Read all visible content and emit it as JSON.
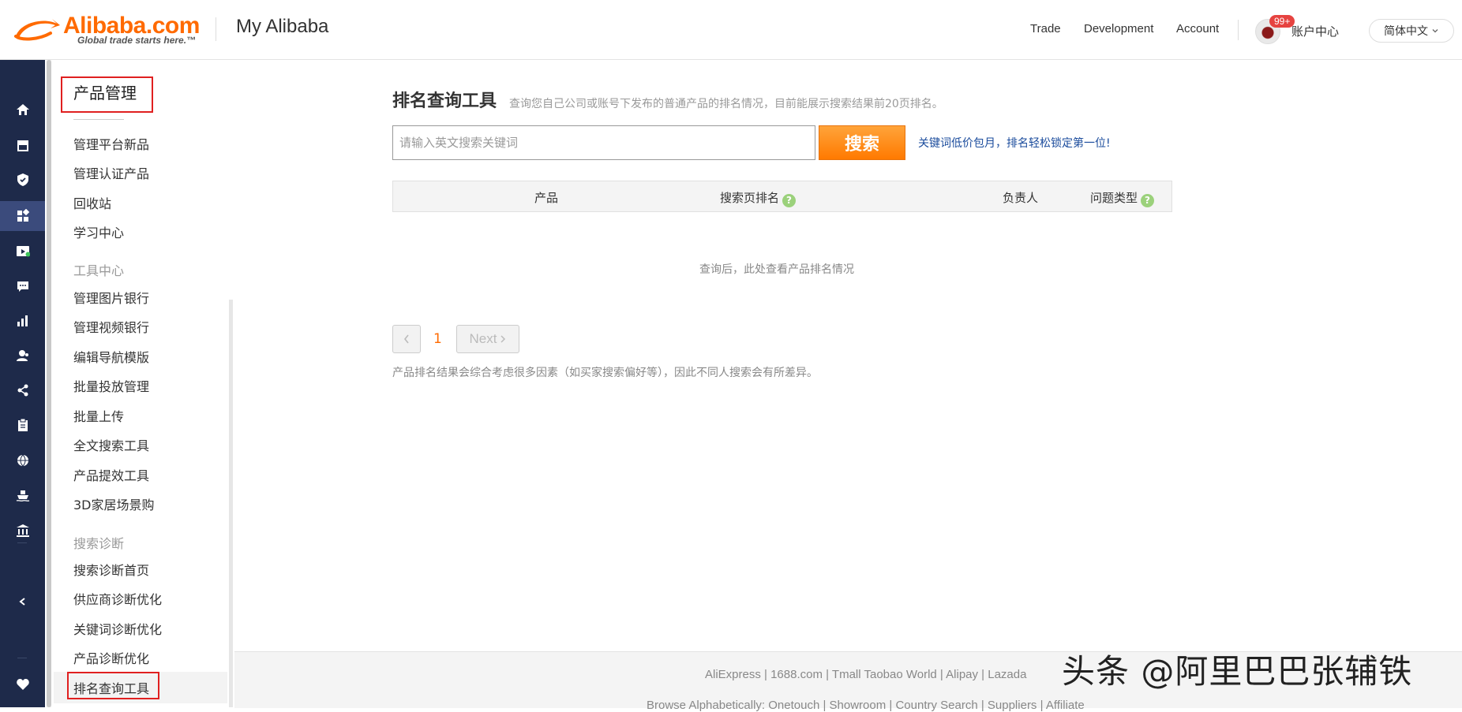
{
  "header": {
    "logo_word": "Alibaba.com",
    "logo_tagline": "Global trade starts here.™",
    "title": "My Alibaba",
    "nav": [
      "Trade",
      "Development",
      "Account"
    ],
    "badge": "99+",
    "account_center": "账户中心",
    "language": "简体中文"
  },
  "rail": {
    "icons": [
      "home-icon",
      "store-icon",
      "shield-icon",
      "apps-icon",
      "video-icon",
      "message-icon",
      "chart-icon",
      "users-icon",
      "network-icon",
      "clipboard-icon",
      "globe-icon",
      "ship-icon",
      "bank-icon",
      "collapse-icon",
      "heart-icon"
    ],
    "active": "apps-icon"
  },
  "sidebar": {
    "title": "产品管理",
    "items_top": [
      "管理平台新品",
      "管理认证产品",
      "回收站",
      "学习中心"
    ],
    "group_tools": "工具中心",
    "items_tools": [
      "管理图片银行",
      "管理视频银行",
      "编辑导航模版",
      "批量投放管理",
      "批量上传",
      "全文搜索工具",
      "产品提效工具",
      "3D家居场景购"
    ],
    "group_search": "搜索诊断",
    "items_search": [
      "搜索诊断首页",
      "供应商诊断优化",
      "关键词诊断优化",
      "产品诊断优化",
      "排名查询工具"
    ]
  },
  "main": {
    "title": "排名查询工具",
    "description": "查询您自己公司或账号下发布的普通产品的排名情况，目前能展示搜索结果前20页排名。",
    "search_placeholder": "请输入英文搜索关键词",
    "search_button": "搜索",
    "promo_link": "关键词低价包月，排名轻松锁定第一位!",
    "columns": [
      "产品",
      "搜索页排名",
      "负责人",
      "问题类型"
    ],
    "help_glyph": "?",
    "empty_text": "查询后，此处查看产品排名情况",
    "pagination": {
      "current": "1",
      "next": "Next"
    },
    "note": "产品排名结果会综合考虑很多因素（如买家搜索偏好等），因此不同人搜索会有所差异。"
  },
  "footer": {
    "links": "AliExpress | 1688.com | Tmall Taobao World | Alipay | Lazada",
    "links2": "Browse Alphabetically: Onetouch | Showroom | Country Search | Suppliers | Affiliate"
  },
  "watermark": "头条 @阿里巴巴张辅铁",
  "colors": {
    "brand": "#ff6a00",
    "rail": "#1e2a4a",
    "link": "#1a4b9c",
    "highlight": "#e02020"
  }
}
